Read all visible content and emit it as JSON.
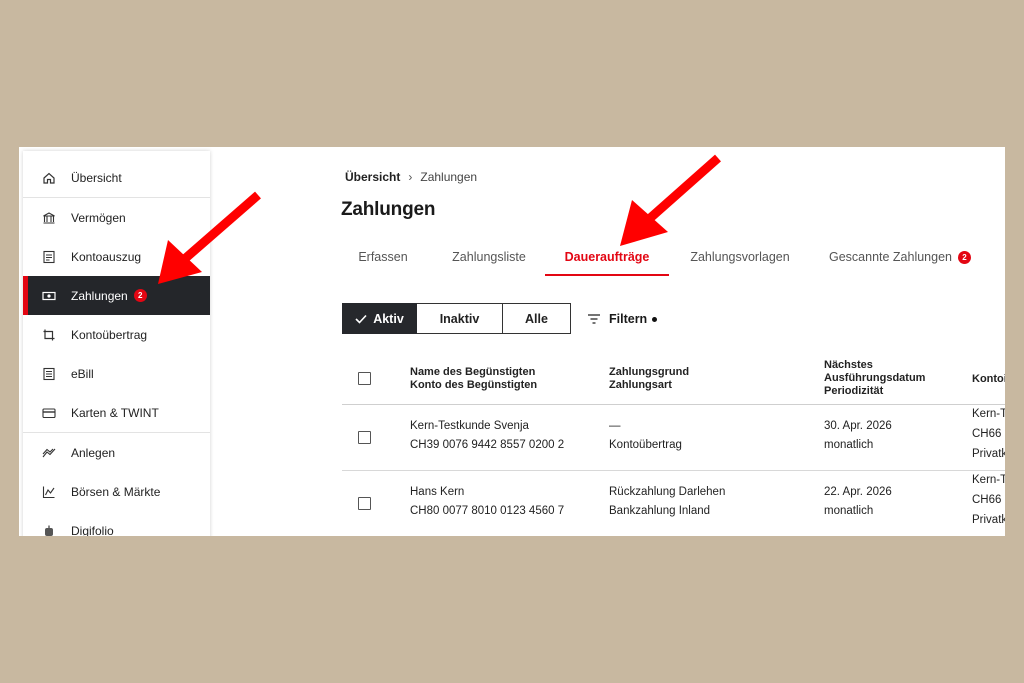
{
  "sidebar": {
    "items": [
      {
        "label": "Übersicht",
        "icon": "home-icon"
      },
      {
        "label": "Vermögen",
        "icon": "bank-icon"
      },
      {
        "label": "Kontoauszug",
        "icon": "statement-icon"
      },
      {
        "label": "Zahlungen",
        "icon": "payment-icon",
        "badge": "2",
        "active": true
      },
      {
        "label": "Kontoübertrag",
        "icon": "transfer-icon"
      },
      {
        "label": "eBill",
        "icon": "ebill-icon"
      },
      {
        "label": "Karten & TWINT",
        "icon": "card-icon"
      },
      {
        "label": "Anlegen",
        "icon": "invest-icon"
      },
      {
        "label": "Börsen & Märkte",
        "icon": "market-icon"
      },
      {
        "label": "Digifolio",
        "icon": "robot-icon"
      }
    ]
  },
  "breadcrumb": {
    "home": "Übersicht",
    "separator": "›",
    "current": "Zahlungen"
  },
  "page_title": "Zahlungen",
  "tabs": [
    {
      "label": "Erfassen"
    },
    {
      "label": "Zahlungsliste"
    },
    {
      "label": "Daueraufträge",
      "active": true
    },
    {
      "label": "Zahlungsvorlagen"
    },
    {
      "label": "Gescannte Zahlungen",
      "badge": "2"
    }
  ],
  "status_filter": {
    "options": [
      "Aktiv",
      "Inaktiv",
      "Alle"
    ],
    "selected": "Aktiv"
  },
  "filter_label": "Filtern",
  "table": {
    "headers": {
      "beneficiary_line1": "Name des Begünstigten",
      "beneficiary_line2": "Konto des Begünstigten",
      "reason_line1": "Zahlungsgrund",
      "reason_line2": "Zahlungsart",
      "date_line1": "Nächstes",
      "date_line2": "Ausführungsdatum",
      "date_line3": "Periodizität",
      "account": "Kontoi"
    },
    "rows": [
      {
        "name": "Kern-Testkunde Svenja",
        "iban": "CH39 0076 9442 8557 0200 2",
        "reason": "—",
        "type": "Kontoübertrag",
        "date": "30. Apr. 2026",
        "period": "monatlich",
        "account_1": "Kern-Te",
        "account_2": "CH66",
        "account_3": "Privatk"
      },
      {
        "name": "Hans Kern",
        "iban": "CH80 0077 8010 0123 4560 7",
        "reason": "Rückzahlung Darlehen",
        "type": "Bankzahlung Inland",
        "date": "22. Apr. 2026",
        "period": "monatlich",
        "account_1": "Kern-Te",
        "account_2": "CH66",
        "account_3": "Privatk"
      }
    ]
  },
  "colors": {
    "accent": "#e30613",
    "active_nav_bg": "#24262a",
    "frame_bg": "#c8b8a0",
    "annotation_arrow": "#ff0000"
  }
}
